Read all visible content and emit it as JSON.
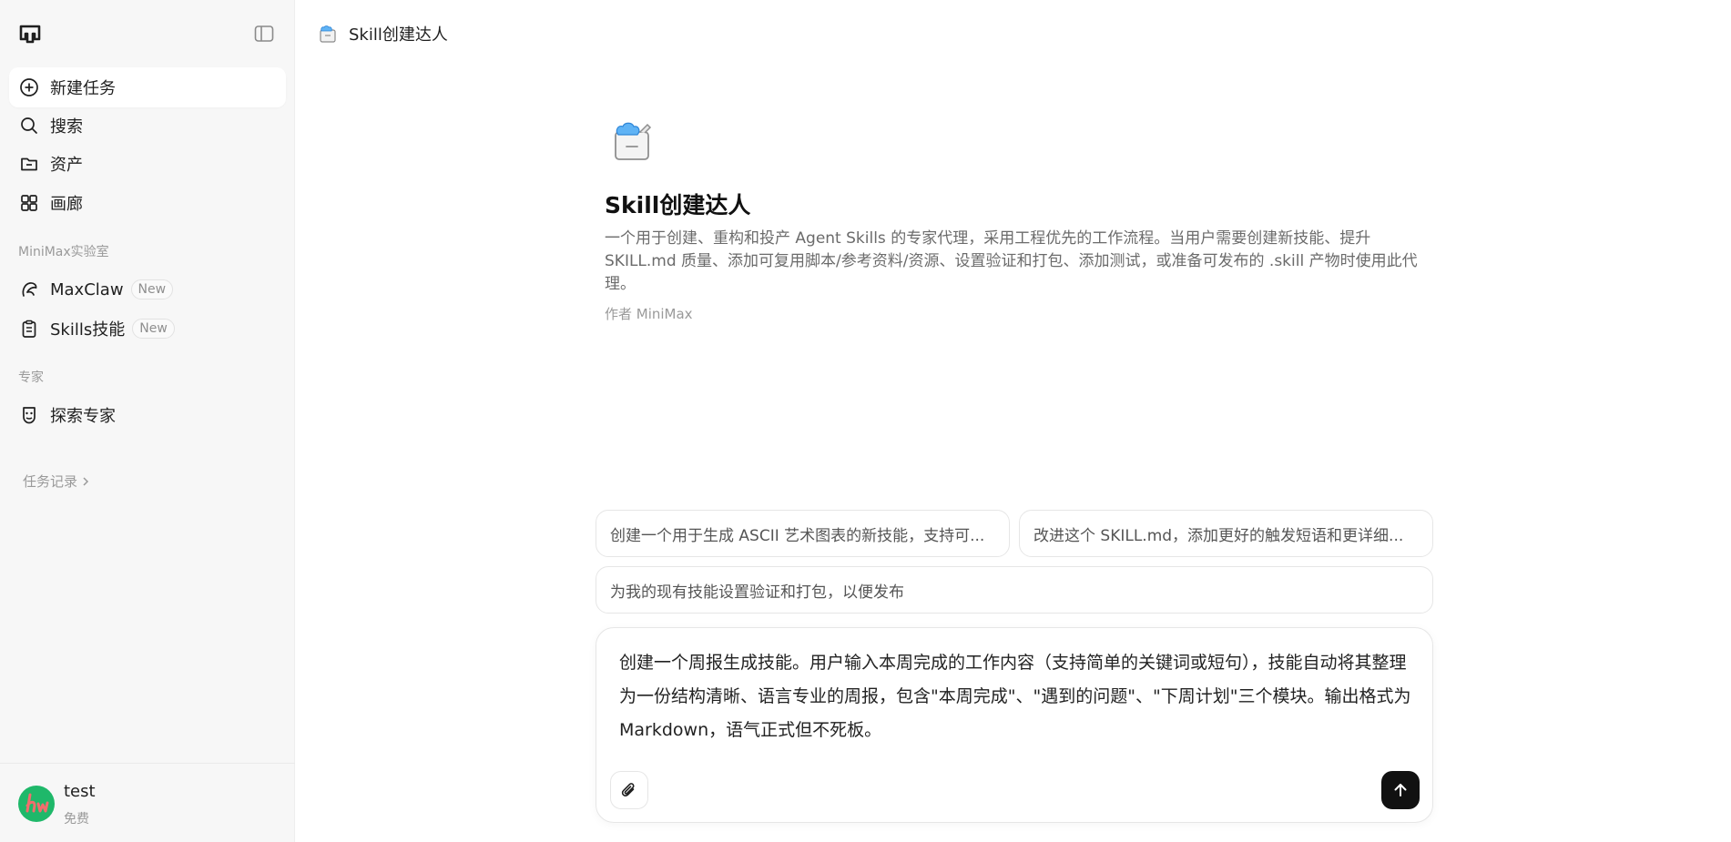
{
  "sidebar": {
    "nav": [
      {
        "label": "新建任务",
        "icon": "plus-circle-icon"
      },
      {
        "label": "搜索",
        "icon": "search-icon"
      },
      {
        "label": "资产",
        "icon": "folder-icon"
      },
      {
        "label": "画廊",
        "icon": "grid-icon"
      }
    ],
    "lab_section": "MiniMax实验室",
    "lab_items": [
      {
        "label": "MaxClaw",
        "badge": "New",
        "icon": "claw-icon"
      },
      {
        "label": "Skills技能",
        "badge": "New",
        "icon": "clipboard-icon"
      }
    ],
    "expert_section": "专家",
    "expert_items": [
      {
        "label": "探索专家",
        "icon": "expert-icon"
      }
    ],
    "history_label": "任务记录",
    "user": {
      "name": "test",
      "plan": "免费"
    }
  },
  "header": {
    "title": "Skill创建达人"
  },
  "agent": {
    "name": "Skill创建达人",
    "description": "一个用于创建、重构和投产 Agent Skills 的专家代理，采用工程优先的工作流程。当用户需要创建新技能、提升 SKILL.md 质量、添加可复用脚本/参考资料/资源、设置验证和打包、添加测试，或准备可发布的 .skill 产物时使用此代理。",
    "author": "作者 MiniMax"
  },
  "suggestions": [
    "创建一个用于生成 ASCII 艺术图表的新技能，支持可...",
    "改进这个 SKILL.md，添加更好的触发短语和更详细...",
    "为我的现有技能设置验证和打包，以便发布"
  ],
  "composer": {
    "text": "创建一个周报生成技能。用户输入本周完成的工作内容（支持简单的关键词或短句），技能自动将其整理为一份结构清晰、语言专业的周报，包含\"本周完成\"、\"遇到的问题\"、\"下周计划\"三个模块。输出格式为 Markdown，语气正式但不死板。"
  },
  "colors": {
    "accent": "#111111",
    "avatar": "#1fb86a",
    "sidebar_bg": "#f7f7f7"
  }
}
